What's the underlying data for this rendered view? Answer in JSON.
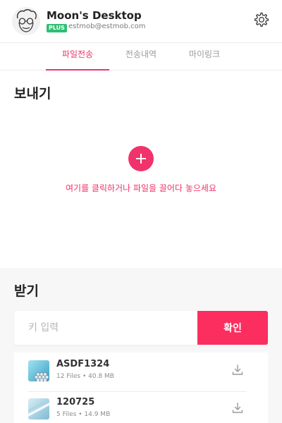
{
  "header": {
    "user_name": "Moon's Desktop",
    "plan_badge": "PLUS",
    "email": "estmob@estmob.com",
    "settings_icon": "gear-icon"
  },
  "tabs": [
    {
      "label": "파일전송",
      "active": true
    },
    {
      "label": "전송내역",
      "active": false
    },
    {
      "label": "마이링크",
      "active": false
    }
  ],
  "send": {
    "title": "보내기",
    "add_icon": "plus-icon",
    "hint": "여기를 클릭하거나 파일을 끌어다 놓으세요"
  },
  "receive": {
    "title": "받기",
    "key_placeholder": "키 입력",
    "key_value": "",
    "confirm_label": "확인",
    "items": [
      {
        "title": "ASDF1324",
        "files": "12 Files",
        "separator": "•",
        "size": "40.8 MB",
        "thumb_icon": "image-thumbnail",
        "action_icon": "download-icon"
      },
      {
        "title": "120725",
        "files": "5 Files",
        "separator": "•",
        "size": "14.9 MB",
        "thumb_icon": "image-thumbnail",
        "action_icon": "download-icon"
      }
    ]
  },
  "colors": {
    "accent": "#f0336b",
    "confirm": "#fb2e5f",
    "plan_badge": "#2fbf71",
    "receive_bg": "#f7f7f8"
  }
}
